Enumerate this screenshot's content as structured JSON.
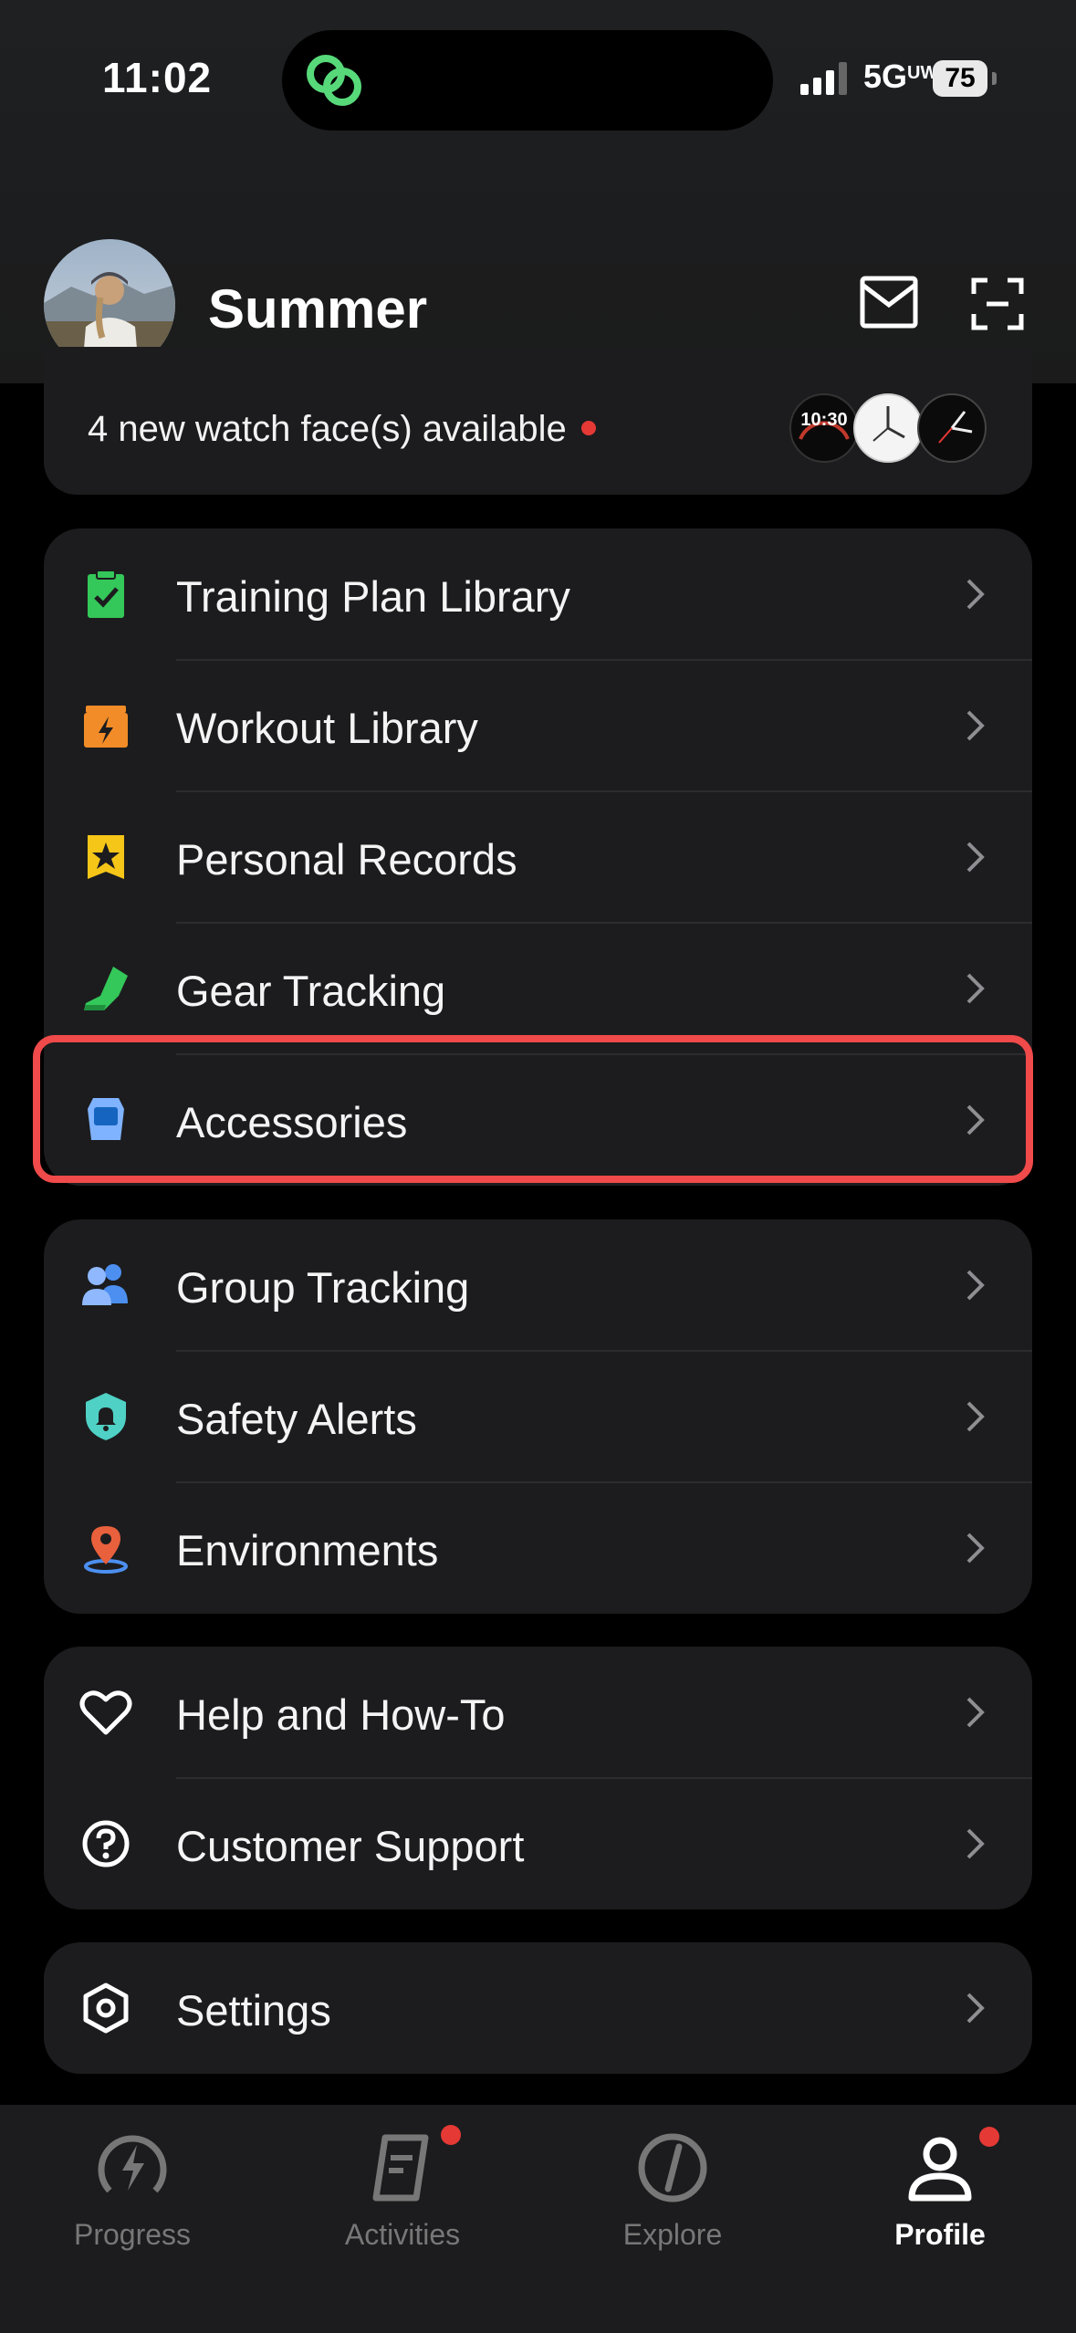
{
  "status_bar": {
    "time": "11:02",
    "network": "5G",
    "network_superscript": "UW",
    "battery": "75"
  },
  "profile": {
    "name": "Summer"
  },
  "watch_faces": {
    "text": "4 new watch face(s) available",
    "face1_time": "10:30"
  },
  "menu_group_1": [
    {
      "label": "Training Plan Library",
      "icon": "clipboard-check-icon"
    },
    {
      "label": "Workout Library",
      "icon": "folder-lightning-icon"
    },
    {
      "label": "Personal Records",
      "icon": "star-badge-icon"
    },
    {
      "label": "Gear Tracking",
      "icon": "shoe-icon"
    },
    {
      "label": "Accessories",
      "icon": "sensor-pod-icon"
    }
  ],
  "menu_group_2": [
    {
      "label": "Group Tracking",
      "icon": "people-icon"
    },
    {
      "label": "Safety Alerts",
      "icon": "shield-bell-icon"
    },
    {
      "label": "Environments",
      "icon": "location-pin-icon"
    }
  ],
  "menu_group_3": [
    {
      "label": "Help and How-To",
      "icon": "heart-icon"
    },
    {
      "label": "Customer Support",
      "icon": "question-circle-icon"
    }
  ],
  "menu_group_4": [
    {
      "label": "Settings",
      "icon": "hexagon-gear-icon"
    }
  ],
  "tabs": [
    {
      "label": "Progress",
      "icon": "lightning-circle-icon",
      "active": false
    },
    {
      "label": "Activities",
      "icon": "activity-doc-icon",
      "active": false,
      "badge": true
    },
    {
      "label": "Explore",
      "icon": "compass-icon",
      "active": false
    },
    {
      "label": "Profile",
      "icon": "person-icon",
      "active": true,
      "badge": true
    }
  ],
  "colors": {
    "highlight": "#f04a4a",
    "badge": "#e53935",
    "card": "#1c1c1e"
  }
}
